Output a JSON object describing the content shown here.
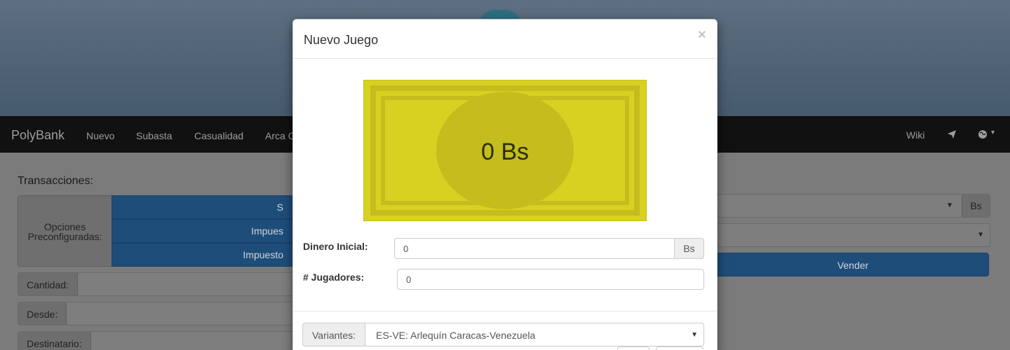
{
  "navbar": {
    "brand": "PolyBank",
    "links": [
      "Nuevo",
      "Subasta",
      "Casualidad",
      "Arca C"
    ],
    "wiki": "Wiki",
    "send_icon": "paper-plane-icon",
    "globe_icon": "globe-icon",
    "caret": "▾"
  },
  "transactions": {
    "title": "Transacciones:",
    "presets_label_1": "Opciones",
    "presets_label_2": "Preconfiguradas:",
    "preset_buttons": [
      "S",
      "Impues",
      "Impuesto"
    ],
    "fields": [
      {
        "label": "Cantidad:"
      },
      {
        "label": "Desde:"
      },
      {
        "label": "Destinatario:"
      }
    ],
    "right_currency": "Bs",
    "sell_button": "Vender"
  },
  "modal": {
    "title": "Nuevo Juego",
    "close": "×",
    "bill_amount": "0 Bs",
    "initial_money": {
      "label": "Dinero Inicial:",
      "value": "0",
      "addon": "Bs"
    },
    "players": {
      "label": "# Jugadores:",
      "value": "0"
    },
    "variants": {
      "label": "Variantes:",
      "selected": "ES-VE: Arlequín Caracas-Venezuela"
    }
  },
  "colors": {
    "bill_outer": "#d8d122",
    "bill_frame": "#c4bd1d",
    "navbar_bg": "#111111",
    "primary_btn": "#1e4d7a"
  }
}
